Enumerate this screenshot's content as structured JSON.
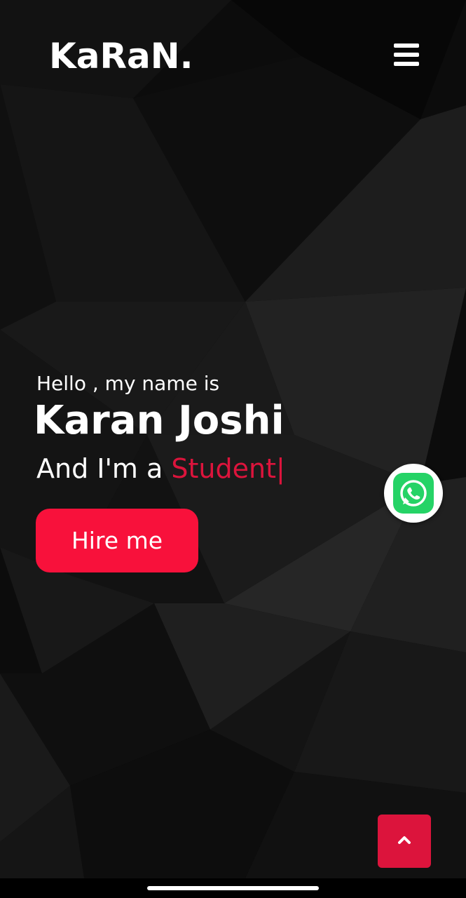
{
  "header": {
    "brand": "KaRaN.",
    "menu_icon": "hamburger-menu-icon"
  },
  "hero": {
    "greeting": "Hello , my name is",
    "name": "Karan Joshi",
    "role_prefix": "And I'm a ",
    "role_typed": "Student",
    "typing_cursor": "|",
    "hire_button": "Hire me"
  },
  "floating": {
    "whatsapp_icon": "whatsapp-icon",
    "scroll_top_icon": "chevron-up-icon"
  },
  "colors": {
    "accent": "#dc143c",
    "button": "#f8113b",
    "whatsapp": "#25d366",
    "background": "#0b0b0b"
  }
}
